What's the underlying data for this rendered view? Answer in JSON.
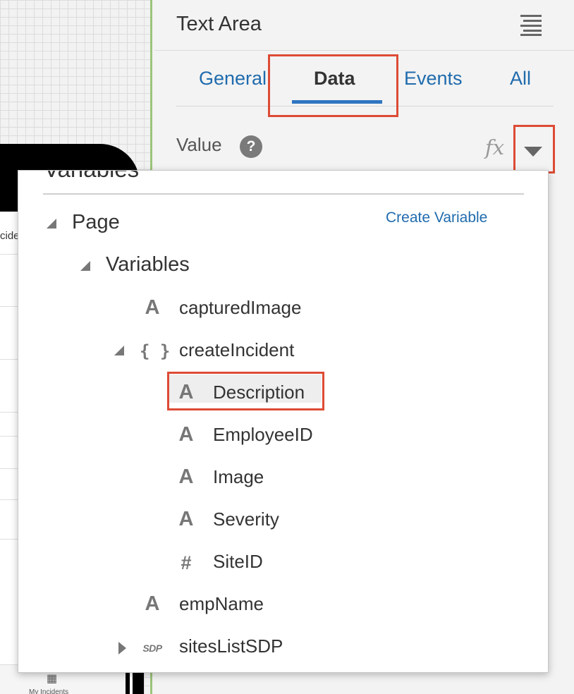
{
  "canvas": {
    "column_label": "cide",
    "tabbar_icon": "list-icon",
    "tabbar_label": "My Incidents"
  },
  "panel": {
    "title": "Text Area",
    "menu_icon": "hamburger-menu-icon",
    "tabs": [
      {
        "label": "General",
        "active": false
      },
      {
        "label": "Data",
        "active": true
      },
      {
        "label": "Events",
        "active": false
      },
      {
        "label": "All",
        "active": false
      }
    ],
    "value_label": "Value",
    "help_glyph": "?",
    "fx_glyph": "fx",
    "highlight_color": "#dd4b35",
    "link_color": "#1f6bad"
  },
  "popup": {
    "heading": "Variables",
    "create_variable": "Create Variable",
    "tree": {
      "page": {
        "label": "Page",
        "expanded": true
      },
      "variables": {
        "label": "Variables",
        "expanded": true
      },
      "captured_image": {
        "label": "capturedImage",
        "type_icon": "A"
      },
      "create_incident": {
        "label": "createIncident",
        "type_icon": "{ }",
        "expanded": true
      },
      "description": {
        "label": "Description",
        "type_icon": "A",
        "selected": true
      },
      "employee_id": {
        "label": "EmployeeID",
        "type_icon": "A"
      },
      "image": {
        "label": "Image",
        "type_icon": "A"
      },
      "severity": {
        "label": "Severity",
        "type_icon": "A"
      },
      "site_id": {
        "label": "SiteID",
        "type_icon": "#"
      },
      "emp_name": {
        "label": "empName",
        "type_icon": "A"
      },
      "sites_list_sdp": {
        "label": "sitesListSDP",
        "type_icon": "SDP",
        "expanded": false
      }
    }
  }
}
